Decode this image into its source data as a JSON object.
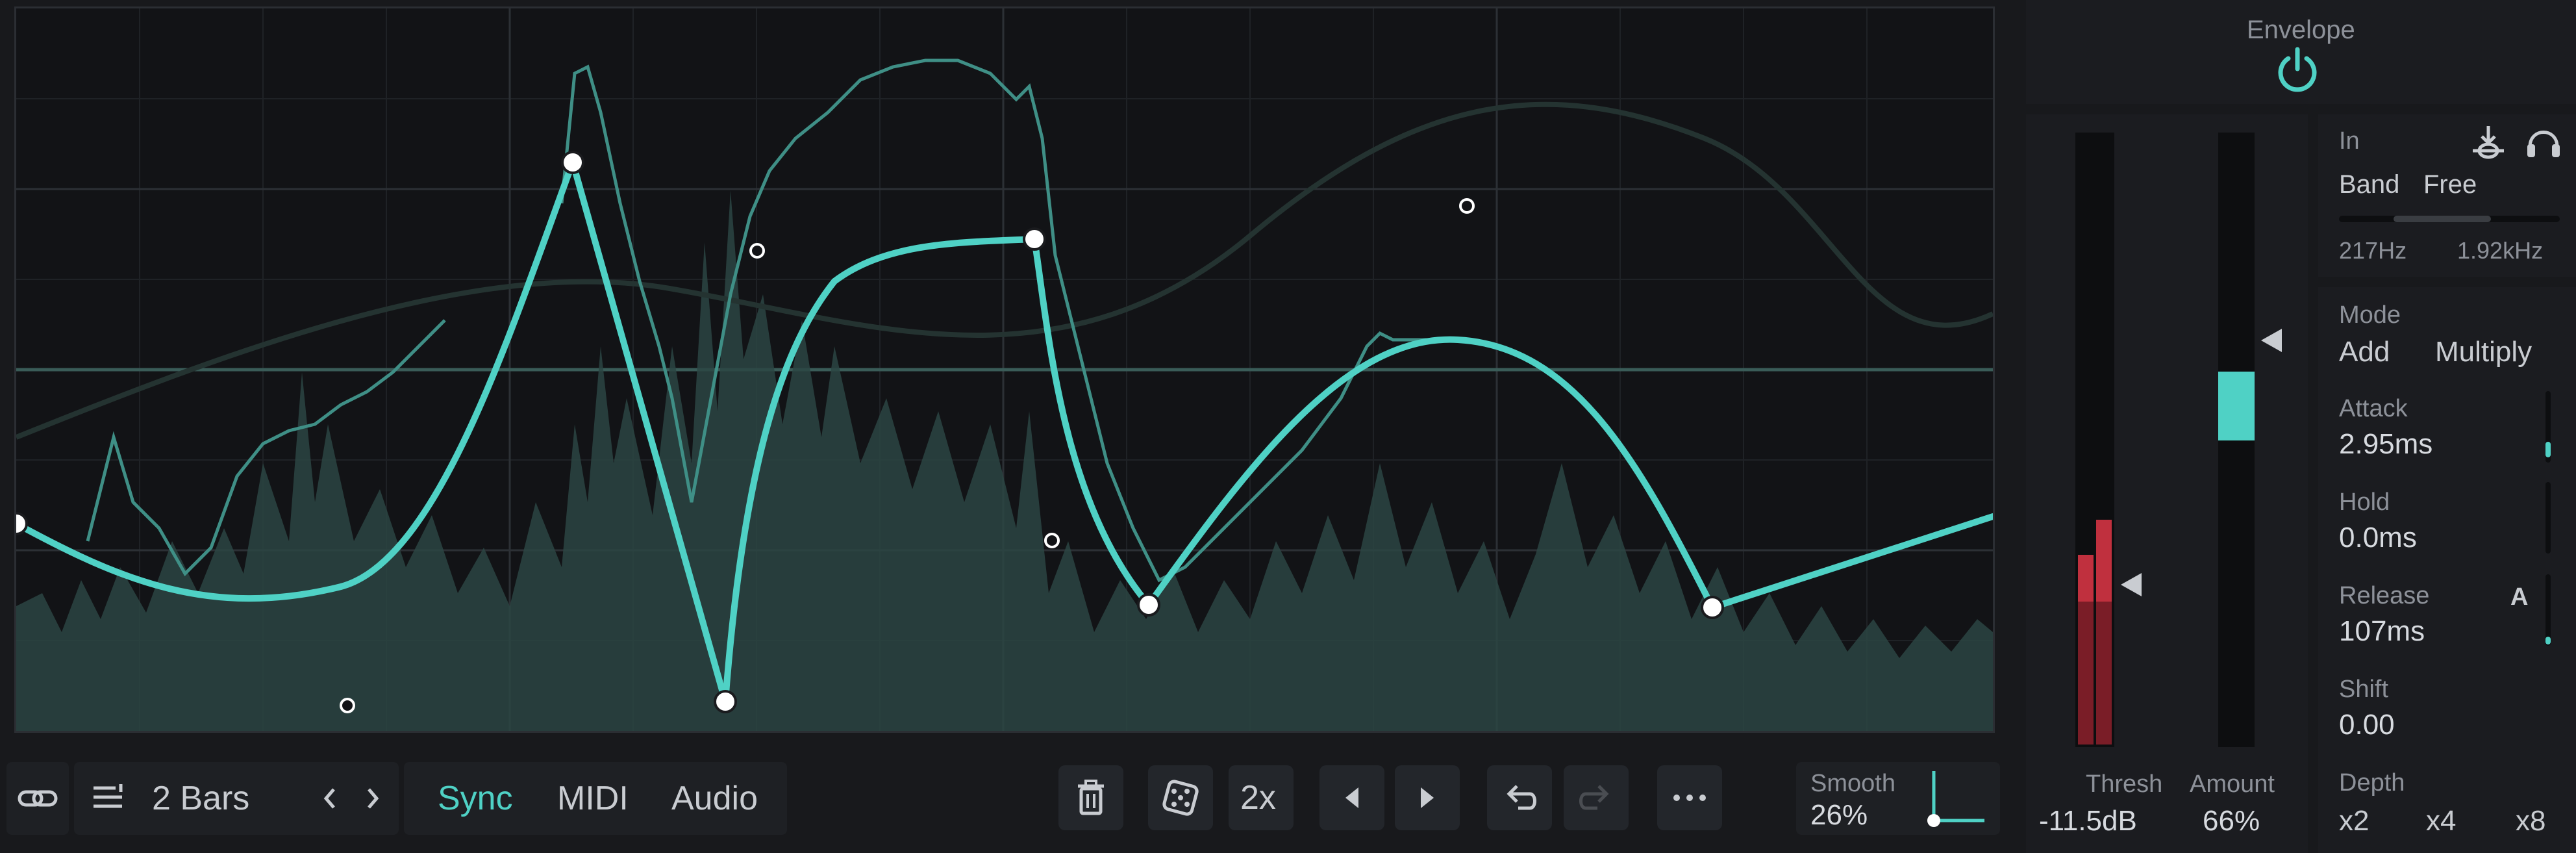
{
  "header": {
    "title": "Envelope"
  },
  "toolbar": {
    "length_label": "2 Bars",
    "modes": [
      {
        "label": "Sync",
        "active": true
      },
      {
        "label": "MIDI",
        "active": false
      },
      {
        "label": "Audio",
        "active": false
      }
    ],
    "multiplier_label": "2x",
    "smooth_label": "Smooth",
    "smooth_value": "26%"
  },
  "meters": {
    "thresh_label": "Thresh",
    "thresh_value": "-11.5dB",
    "amount_label": "Amount",
    "amount_value": "66%"
  },
  "input": {
    "label": "In",
    "band_label": "Band",
    "free_label": "Free",
    "freq_low": "217Hz",
    "freq_high": "1.92kHz"
  },
  "mode": {
    "label": "Mode",
    "add_label": "Add",
    "multiply_label": "Multiply",
    "selected": "Add"
  },
  "params": {
    "attack_label": "Attack",
    "attack_value": "2.95ms",
    "hold_label": "Hold",
    "hold_value": "0.0ms",
    "release_label": "Release",
    "release_value": "107ms",
    "release_auto": "A",
    "shift_label": "Shift",
    "shift_value": "0.00"
  },
  "depth": {
    "label": "Depth",
    "options": [
      "x2",
      "x4",
      "x8"
    ],
    "selected": "x2"
  },
  "colors": {
    "accent": "#4fd1c5",
    "meter_red": "#c0303e",
    "background": "#18191c"
  }
}
